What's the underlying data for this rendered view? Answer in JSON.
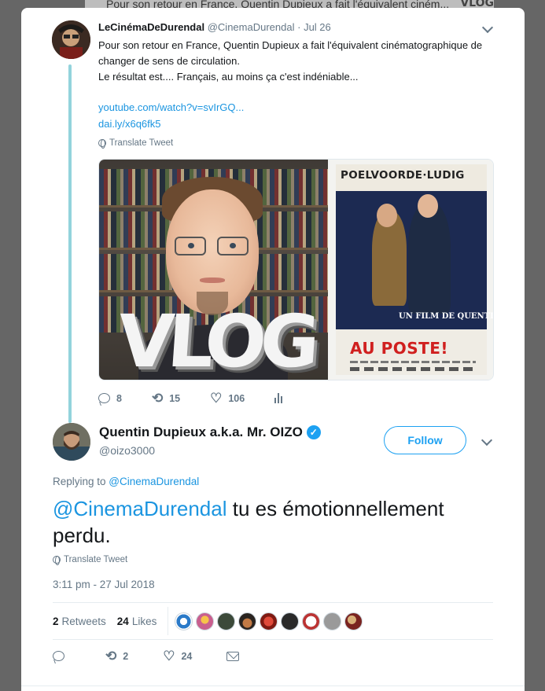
{
  "backdrop": {
    "tweet_text": "Pour son retour en France, Quentin Dupieux a fait l'équivalent ciném...",
    "thumb_text": "VLOG"
  },
  "tweet1": {
    "display_name": "LeCinémaDeDurendal",
    "handle": "@CinemaDurendal",
    "separator": "·",
    "date": "Jul 26",
    "text_line1": "Pour son retour en France, Quentin Dupieux a fait l'équivalent cinématographique de changer de sens de circulation.",
    "text_line2": "Le résultat est.... Français, au moins ça c'est indéniable...",
    "link1": "youtube.com/watch?v=svIrGQ...",
    "link2": "dai.ly/x6q6fk5",
    "translate_label": "Translate Tweet",
    "media": {
      "vlog_text": "VLOG",
      "poster_names": "POELVOORDE·LUDIG",
      "poster_film_by": "UN FILM DE QUENTIN DUPIEUX",
      "poster_title": "AU POSTE!"
    },
    "actions": {
      "replies": "8",
      "retweets": "15",
      "likes": "106"
    }
  },
  "tweet2": {
    "display_name": "Quentin Dupieux a.k.a. Mr. OIZO",
    "handle": "@oizo3000",
    "verified_glyph": "✓",
    "follow_label": "Follow",
    "replying_prefix": "Replying to ",
    "replying_to": "@CinemaDurendal",
    "mention": "@CinemaDurendal",
    "text": " tu es émotionnellement perdu.",
    "translate_label": "Translate Tweet",
    "timestamp": "3:11 pm - 27 Jul 2018",
    "retweets_count": "2",
    "retweets_label": "Retweets",
    "likes_count": "24",
    "likes_label": "Likes",
    "actions": {
      "replies": "",
      "retweets": "2",
      "likes": "24"
    }
  },
  "icons": {
    "reply": "reply-icon",
    "retweet": "⟲",
    "retweet_name": "retweet-icon",
    "like": "♡",
    "like_name": "heart-icon",
    "stats_name": "analytics-icon",
    "mail_name": "direct-message-icon",
    "globe_name": "globe-icon"
  },
  "colors": {
    "link": "#1b95e0",
    "muted": "#657786",
    "thread_line": "#93d3dc",
    "follow": "#1da1f2",
    "poster_title": "#d0201f"
  }
}
